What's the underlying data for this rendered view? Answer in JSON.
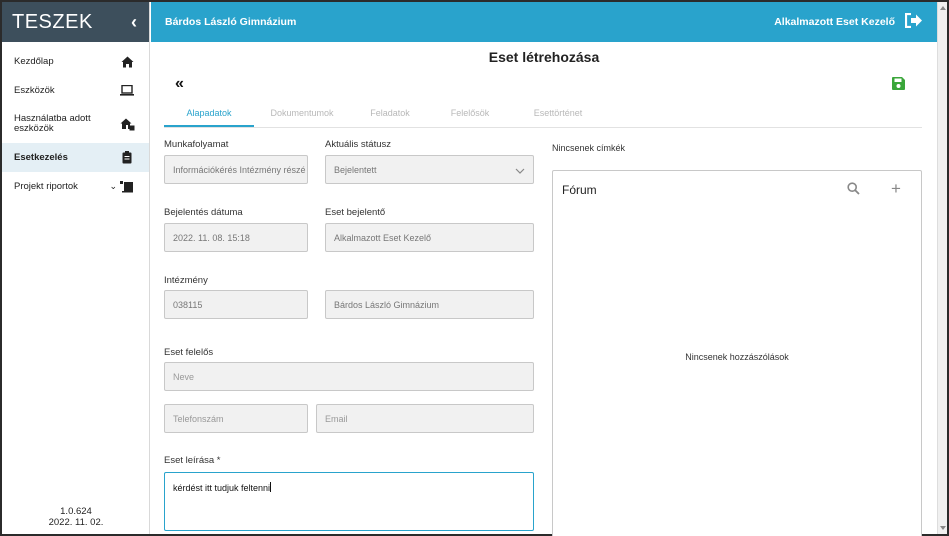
{
  "sidebar": {
    "brand": "TESZEK",
    "collapse_icon": "chevron-left-icon",
    "items": [
      {
        "label": "Kezdőlap",
        "icon": "home-icon"
      },
      {
        "label": "Eszközök",
        "icon": "laptop-icon"
      },
      {
        "label": "Használatba adott eszközök",
        "icon": "house-check-icon"
      },
      {
        "label": "Esetkezelés",
        "icon": "clipboard-icon",
        "active": true
      },
      {
        "label": "Projekt riportok",
        "icon": "report-icon"
      }
    ],
    "version": "1.0.624",
    "version_date": "2022. 11. 02."
  },
  "topbar": {
    "school": "Bárdos László Gimnázium",
    "user": "Alkalmazott Eset Kezelő",
    "logout_icon": "sign-out-icon"
  },
  "page": {
    "title": "Eset létrehozása",
    "back_icon": "double-chevron-left-icon",
    "save_icon": "floppy-disk-icon"
  },
  "tabs": [
    "Alapadatok",
    "Dokumentumok",
    "Feladatok",
    "Felelősök",
    "Esettörténet"
  ],
  "form": {
    "workflow_label": "Munkafolyamat",
    "workflow_value": "Információkérés Intézmény részé",
    "status_label": "Aktuális státusz",
    "status_value": "Bejelentett",
    "report_date_label": "Bejelentés dátuma",
    "report_date_value": "2022. 11. 08. 15:18",
    "reporter_label": "Eset bejelentő",
    "reporter_value": "Alkalmazott Eset Kezelő",
    "institution_label": "Intézmény",
    "institution_code": "038115",
    "institution_name": "Bárdos László Gimnázium",
    "responsible_label": "Eset felelős",
    "name_placeholder": "Neve",
    "phone_placeholder": "Telefonszám",
    "email_placeholder": "Email",
    "description_label": "Eset leírása *",
    "description_value": "kérdést itt tudjuk feltenni"
  },
  "tags": {
    "empty_text": "Nincsenek címkék"
  },
  "forum": {
    "title": "Fórum",
    "empty_text": "Nincsenek hozzászólások",
    "search_icon": "search-icon",
    "add_icon": "plus-icon"
  },
  "colors": {
    "accent": "#29a3cc",
    "sidebar_header": "#3d4f5c",
    "active_item_bg": "#e4eff5",
    "save_icon": "#3aa63a"
  }
}
